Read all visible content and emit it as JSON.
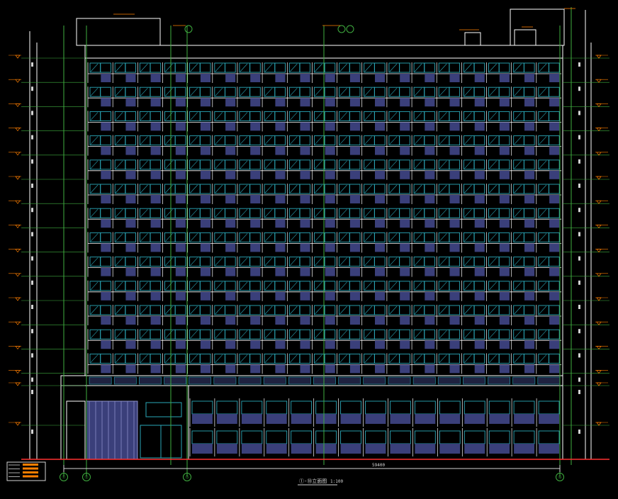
{
  "drawing": {
    "caption": "①-⑩立面图",
    "scale": "1:100",
    "overall_dim": "59400",
    "axis_labels": [
      "⑪",
      "⑫",
      "⑮",
      "⑯"
    ],
    "legend_rows": [
      "",
      "",
      "",
      ""
    ]
  },
  "building": {
    "tower_floors": 13,
    "tower_columns": 19,
    "podium_columns": 15
  },
  "colors": {
    "background": "#000000",
    "outline": "#ffffff",
    "window_fill": "#3a3f7a",
    "window_frame": "#2aa7b7",
    "grid_line": "#3fae3f",
    "annotation": "#ff7f00",
    "ground_line": "#ff3030",
    "dimension": "#d4d4d4"
  }
}
